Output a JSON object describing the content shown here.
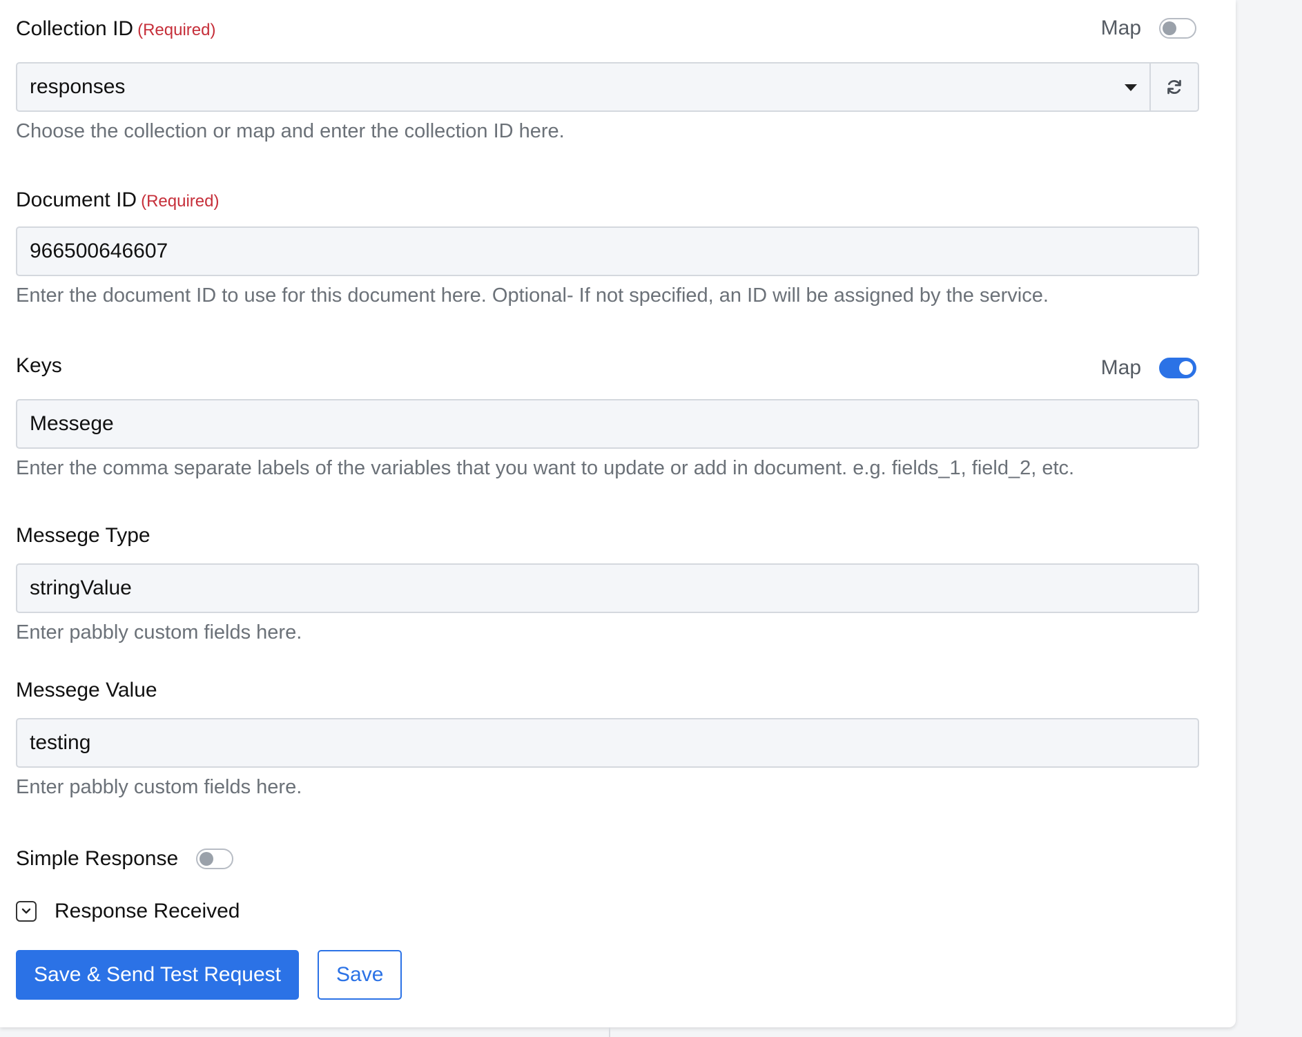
{
  "collection": {
    "label": "Collection ID",
    "required": "(Required)",
    "map_label": "Map",
    "map_on": false,
    "value": "responses",
    "help": "Choose the collection or map and enter the collection ID here."
  },
  "document": {
    "label": "Document ID",
    "required": "(Required)",
    "value": "966500646607",
    "help": "Enter the document ID to use for this document here. Optional- If not specified, an ID will be assigned by the service."
  },
  "keys": {
    "label": "Keys",
    "map_label": "Map",
    "map_on": true,
    "value": "Messege",
    "help": "Enter the comma separate labels of the variables that you want to update or add in document. e.g. fields_1, field_2, etc."
  },
  "messege_type": {
    "label": "Messege Type",
    "value": "stringValue",
    "help": "Enter pabbly custom fields here."
  },
  "messege_value": {
    "label": "Messege Value",
    "value": "testing",
    "help": "Enter pabbly custom fields here."
  },
  "simple_response": {
    "label": "Simple Response",
    "on": false
  },
  "response_received": {
    "label": "Response Received"
  },
  "buttons": {
    "save_send": "Save & Send Test Request",
    "save": "Save"
  },
  "colors": {
    "accent": "#2b72e6",
    "required": "#c62f3a"
  }
}
